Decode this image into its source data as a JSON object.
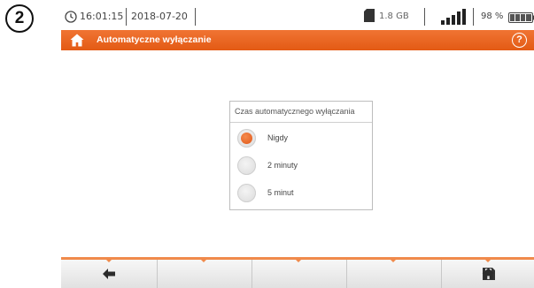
{
  "step_marker": "2",
  "status": {
    "time": "16:01:15",
    "date": "2018-07-20",
    "storage": "1.8 GB",
    "battery_percent": "98 %",
    "signal_bars": 5,
    "icons": [
      "clock-icon",
      "sd-card-icon",
      "signal-icon",
      "battery-icon",
      "plug-icon"
    ]
  },
  "header": {
    "title": "Automatyczne wyłączanie",
    "accent_color": "#e8621e",
    "icons": [
      "home-icon",
      "help-icon"
    ]
  },
  "dialog": {
    "title": "Czas automatycznego wyłączania",
    "options": [
      {
        "label": "Nigdy",
        "selected": true
      },
      {
        "label": "2 minuty",
        "selected": false
      },
      {
        "label": "5 minut",
        "selected": false
      }
    ]
  },
  "toolbar": {
    "buttons": [
      {
        "icon": "back-arrow-icon"
      },
      {
        "icon": ""
      },
      {
        "icon": ""
      },
      {
        "icon": ""
      },
      {
        "icon": "save-icon"
      },
      {
        "icon": "home-icon"
      }
    ]
  }
}
